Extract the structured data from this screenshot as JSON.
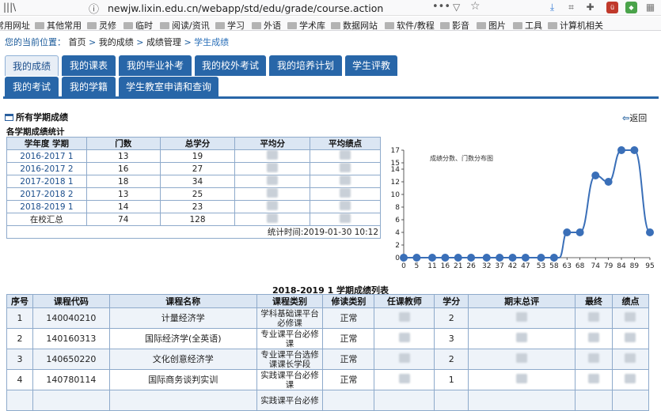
{
  "browser": {
    "library_glyph": "|||\\",
    "url": "newjw.lixin.edu.cn/webapp/std/edu/grade/course.action",
    "info_icon": "info-icon",
    "page_actions": "•••",
    "bookmarks": [
      "常用网址",
      "其他常用",
      "灵修",
      "临时",
      "阅读/资讯",
      "学习",
      "外语",
      "学术库",
      "数据网站",
      "软件/教程",
      "影音",
      "图片",
      "工具",
      "计算机相关"
    ]
  },
  "breadcrumb": {
    "prefix": "您的当前位置：",
    "items": [
      "首页",
      "我的成绩",
      "成绩管理",
      "学生成绩"
    ],
    "separator": ">"
  },
  "tabs": [
    {
      "label": "我的成绩",
      "selected": true
    },
    {
      "label": "我的课表"
    },
    {
      "label": "我的毕业补考"
    },
    {
      "label": "我的校外考试"
    },
    {
      "label": "我的培养计划"
    },
    {
      "label": "学生评教"
    },
    {
      "label": "我的考试"
    },
    {
      "label": "我的学籍"
    },
    {
      "label": "学生教室申请和查询"
    }
  ],
  "section": {
    "title": "所有学期成绩",
    "back_label": "返回"
  },
  "stats": {
    "title": "各学期成绩统计",
    "headers": [
      "学年度 学期",
      "门数",
      "总学分",
      "平均分",
      "平均绩点"
    ],
    "rows": [
      {
        "term": "2016-2017 1",
        "count": "13",
        "credits": "19"
      },
      {
        "term": "2016-2017 2",
        "count": "16",
        "credits": "27"
      },
      {
        "term": "2017-2018 1",
        "count": "18",
        "credits": "34"
      },
      {
        "term": "2017-2018 2",
        "count": "13",
        "credits": "25"
      },
      {
        "term": "2018-2019 1",
        "count": "14",
        "credits": "23"
      }
    ],
    "summary": {
      "term": "在校汇总",
      "count": "74",
      "credits": "128"
    },
    "footer": "统计时间:2019-01-30 10:12"
  },
  "chart_data": {
    "type": "line",
    "title": "成绩分数、门数分布图",
    "x": [
      0,
      5,
      11,
      16,
      21,
      26,
      32,
      37,
      42,
      47,
      53,
      58,
      63,
      68,
      74,
      79,
      84,
      89,
      95
    ],
    "series": [
      {
        "values": [
          0,
          0,
          0,
          0,
          0,
          0,
          0,
          0,
          0,
          0,
          0,
          0,
          0,
          4,
          4,
          13,
          12,
          17,
          17,
          4
        ]
      }
    ],
    "x_points": [
      0,
      5,
      11,
      16,
      21,
      26,
      32,
      37,
      42,
      47,
      53,
      58,
      60,
      63,
      68,
      74,
      79,
      84,
      89,
      95
    ],
    "ylim": [
      0,
      17
    ],
    "yticks": [
      0,
      2,
      4,
      6,
      8,
      10,
      12,
      14,
      15,
      17
    ],
    "color": "#3a6fb8",
    "grid": false
  },
  "grades": {
    "title": "2018-2019 1 学期成绩列表",
    "headers": [
      "序号",
      "课程代码",
      "课程名称",
      "课程类别",
      "修读类别",
      "任课教师",
      "学分",
      "期末总评",
      "最终",
      "绩点"
    ],
    "rows": [
      {
        "no": "1",
        "code": "140040210",
        "name": "计量经济学",
        "category": "学科基础课平台必修课",
        "study": "正常",
        "credit": "2"
      },
      {
        "no": "2",
        "code": "140160313",
        "name": "国际经济学(全英语)",
        "category": "专业课平台必修课",
        "study": "正常",
        "credit": "3"
      },
      {
        "no": "3",
        "code": "140650220",
        "name": "文化创意经济学",
        "category": "专业课平台选修课课长学段",
        "study": "正常",
        "credit": "2"
      },
      {
        "no": "4",
        "code": "140780114",
        "name": "国际商务谈判实训",
        "category": "实践课平台必修课",
        "study": "正常",
        "credit": "1"
      },
      {
        "no": "",
        "code": "",
        "name": "",
        "category": "实践课平台必修",
        "study": "",
        "credit": ""
      }
    ]
  },
  "colors": {
    "tab": "#2866a8",
    "link": "#1a5a9a",
    "header_bg": "#dbe6f3",
    "border": "#8eaacb"
  }
}
